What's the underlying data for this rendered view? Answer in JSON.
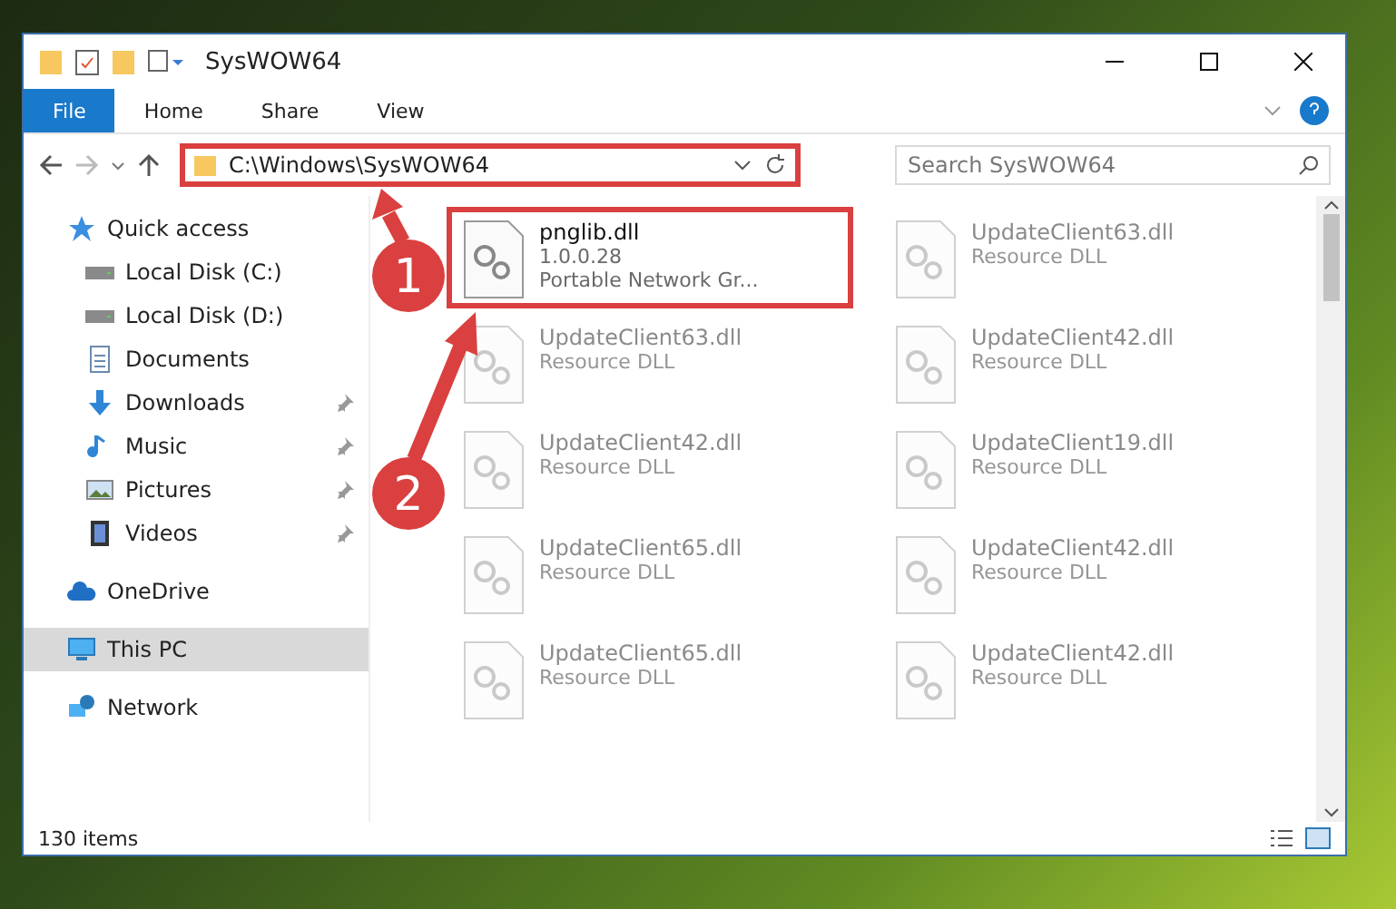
{
  "window": {
    "title": "SysWOW64"
  },
  "ribbon": {
    "tabs": [
      {
        "label": "File",
        "selected": true
      },
      {
        "label": "Home",
        "selected": false
      },
      {
        "label": "Share",
        "selected": false
      },
      {
        "label": "View",
        "selected": false
      }
    ]
  },
  "address": {
    "path": "C:\\Windows\\SysWOW64",
    "highlighted": true
  },
  "search": {
    "placeholder": "Search SysWOW64"
  },
  "sidebar": {
    "items": [
      {
        "label": "Quick access",
        "kind": "star",
        "selected": false,
        "children": [
          {
            "label": "Local Disk (C:)",
            "kind": "drive",
            "pinned": false,
            "selected": false
          },
          {
            "label": "Local Disk (D:)",
            "kind": "drive",
            "pinned": false,
            "selected": false
          },
          {
            "label": "Documents",
            "kind": "document",
            "pinned": false,
            "selected": false
          },
          {
            "label": "Downloads",
            "kind": "download",
            "pinned": true,
            "selected": false
          },
          {
            "label": "Music",
            "kind": "music",
            "pinned": true,
            "selected": false
          },
          {
            "label": "Pictures",
            "kind": "picture",
            "pinned": true,
            "selected": false
          },
          {
            "label": "Videos",
            "kind": "video",
            "pinned": true,
            "selected": false
          }
        ]
      },
      {
        "label": "OneDrive",
        "kind": "cloud",
        "selected": false
      },
      {
        "label": "This PC",
        "kind": "pc",
        "selected": true
      },
      {
        "label": "Network",
        "kind": "network",
        "selected": false
      }
    ]
  },
  "files": [
    {
      "name": "pnglib.dll",
      "details": [
        "1.0.0.28",
        "Portable Network Gr..."
      ],
      "blurred": false,
      "highlighted": true
    },
    {
      "name": "UpdateClient63.dll",
      "details": [
        "Resource DLL"
      ],
      "blurred": true,
      "highlighted": false
    },
    {
      "name": "UpdateClient63.dll",
      "details": [
        "Resource DLL"
      ],
      "blurred": true,
      "highlighted": false
    },
    {
      "name": "UpdateClient42.dll",
      "details": [
        "Resource DLL"
      ],
      "blurred": true,
      "highlighted": false
    },
    {
      "name": "UpdateClient42.dll",
      "details": [
        "Resource DLL"
      ],
      "blurred": true,
      "highlighted": false
    },
    {
      "name": "UpdateClient19.dll",
      "details": [
        "Resource DLL"
      ],
      "blurred": true,
      "highlighted": false
    },
    {
      "name": "UpdateClient65.dll",
      "details": [
        "Resource DLL"
      ],
      "blurred": true,
      "highlighted": false
    },
    {
      "name": "UpdateClient42.dll",
      "details": [
        "Resource DLL"
      ],
      "blurred": true,
      "highlighted": false
    },
    {
      "name": "UpdateClient65.dll",
      "details": [
        "Resource DLL"
      ],
      "blurred": true,
      "highlighted": false
    },
    {
      "name": "UpdateClient42.dll",
      "details": [
        "Resource DLL"
      ],
      "blurred": true,
      "highlighted": false
    }
  ],
  "status_bar": {
    "count": "130 items"
  },
  "callouts": [
    {
      "label": "1"
    },
    {
      "label": "2"
    }
  ]
}
